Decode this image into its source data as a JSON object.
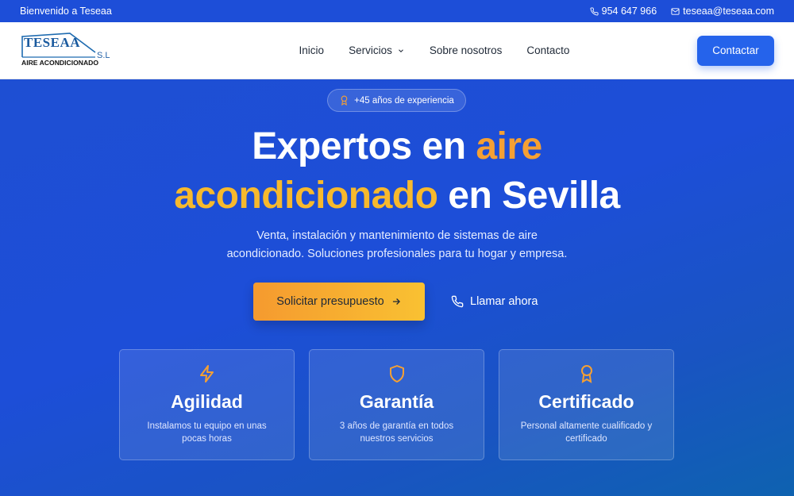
{
  "topbar": {
    "welcome": "Bienvenido a Teseaa",
    "phone": "954 647 966",
    "email": "teseaa@teseaa.com"
  },
  "logo": {
    "name": "TESEAA",
    "suffix": "S.L",
    "subtitle": "AIRE ACONDICIONADO"
  },
  "nav": {
    "items": [
      {
        "label": "Inicio"
      },
      {
        "label": "Servicios"
      },
      {
        "label": "Sobre nosotros"
      },
      {
        "label": "Contacto"
      }
    ],
    "cta_label": "Contactar"
  },
  "hero": {
    "badge": "+45 años de experiencia",
    "headline_part1": "Expertos en ",
    "headline_accent1": "aire",
    "headline_accent2": "acondicionado",
    "headline_part2": " en Sevilla",
    "subtitle_line1": "Venta, instalación y mantenimiento de sistemas de aire",
    "subtitle_line2": "acondicionado. Soluciones profesionales para tu hogar y empresa.",
    "primary_button": "Solicitar presupuesto",
    "secondary_button": "Llamar ahora"
  },
  "features": [
    {
      "icon": "lightning-icon",
      "title": "Agilidad",
      "desc": "Instalamos tu equipo en unas pocas horas"
    },
    {
      "icon": "shield-icon",
      "title": "Garantía",
      "desc": "3 años de garantía en todos nuestros servicios"
    },
    {
      "icon": "award-icon",
      "title": "Certificado",
      "desc": "Personal altamente cualificado y certificado"
    }
  ],
  "colors": {
    "brand_blue": "#1d4ed8",
    "accent_orange": "#f5a033",
    "accent_yellow": "#f7b92d"
  }
}
